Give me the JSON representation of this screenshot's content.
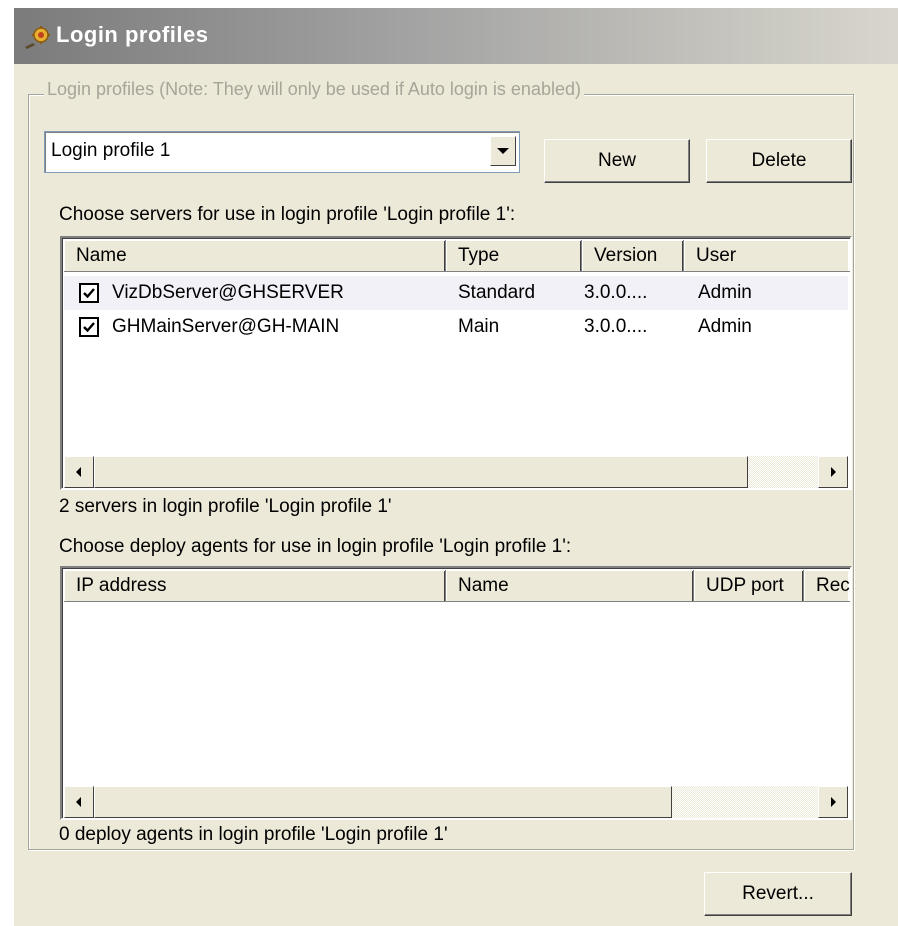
{
  "header": {
    "title": "Login profiles",
    "icon": "gear-plug-icon"
  },
  "group": {
    "legend": "Login profiles (Note: They will only be used if Auto login is enabled)"
  },
  "profile_select": {
    "value": "Login profile 1"
  },
  "buttons": {
    "new": "New",
    "delete": "Delete",
    "revert": "Revert..."
  },
  "servers": {
    "prompt": "Choose servers for use in login profile 'Login profile 1':",
    "columns": [
      "Name",
      "Type",
      "Version",
      "User"
    ],
    "rows": [
      {
        "checked": true,
        "name": "VizDbServer@GHSERVER",
        "type": "Standard",
        "version": "3.0.0....",
        "user": "Admin"
      },
      {
        "checked": true,
        "name": "GHMainServer@GH-MAIN",
        "type": "Main",
        "version": "3.0.0....",
        "user": "Admin"
      }
    ],
    "count_text": "2 servers in login profile 'Login profile 1'"
  },
  "agents": {
    "prompt": "Choose deploy agents for use in login profile 'Login profile 1':",
    "columns": [
      "IP address",
      "Name",
      "UDP port",
      "Rec"
    ],
    "rows": [],
    "count_text": "0 deploy agents in login profile 'Login profile 1'"
  },
  "colors": {
    "titlebar_start": "#7b7b7b",
    "titlebar_end": "#d8d6cc",
    "dialog_bg": "#ece9d8",
    "legend_text": "#a5a598"
  }
}
